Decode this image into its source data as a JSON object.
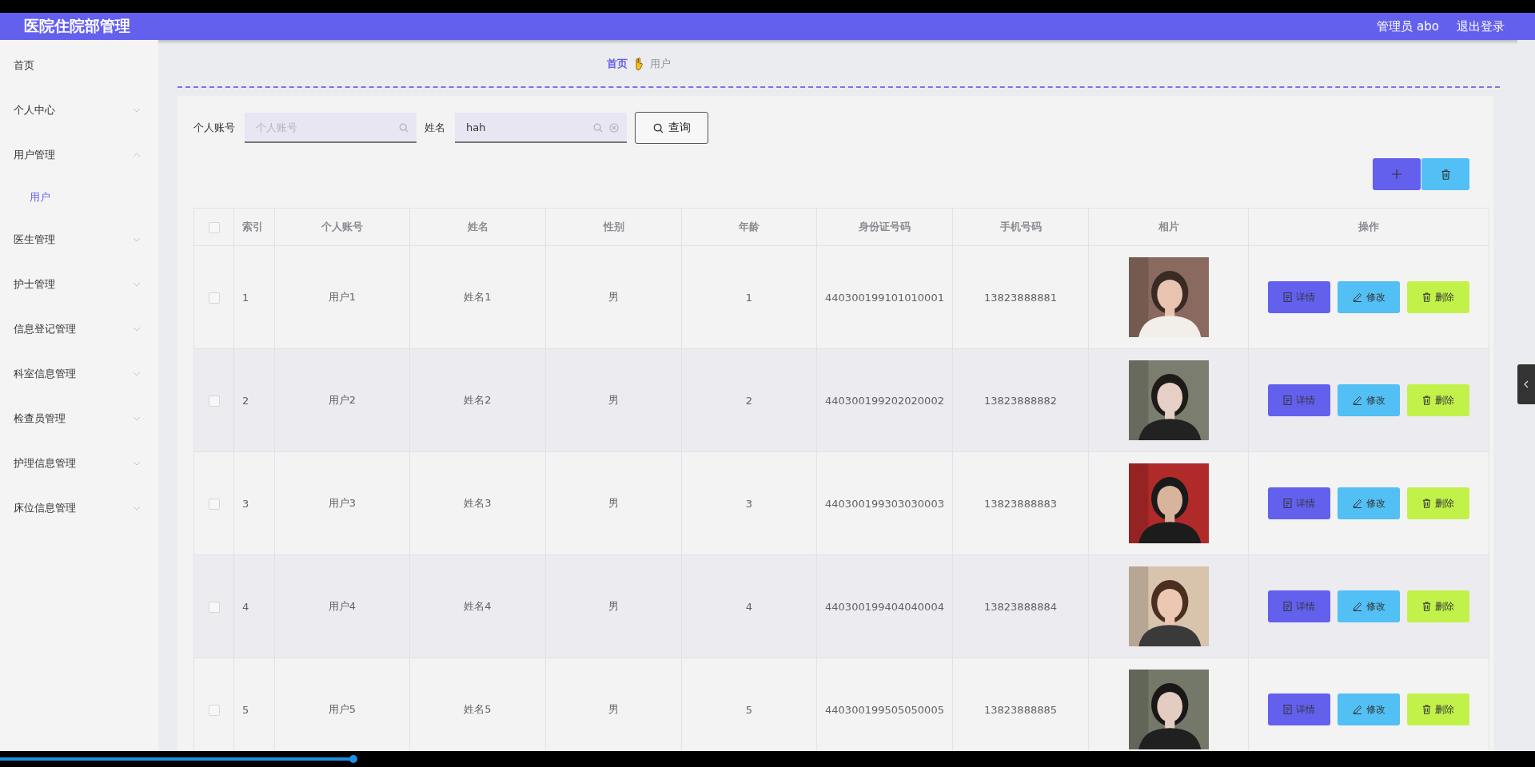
{
  "header": {
    "title": "医院住院部管理",
    "user": "管理员 abo",
    "logout": "退出登录"
  },
  "sidebar": {
    "items": [
      {
        "label": "首页",
        "selected": false
      },
      {
        "label": "个人中心",
        "expandable": true,
        "expanded": false,
        "selected": false
      },
      {
        "label": "用户管理",
        "expandable": true,
        "expanded": true,
        "selected": false,
        "children": [
          {
            "label": "用户",
            "selected": true
          }
        ]
      },
      {
        "label": "医生管理",
        "expandable": true,
        "expanded": false,
        "selected": false
      },
      {
        "label": "护士管理",
        "expandable": true,
        "expanded": false,
        "selected": false
      },
      {
        "label": "信息登记管理",
        "expandable": true,
        "expanded": false,
        "selected": false
      },
      {
        "label": "科室信息管理",
        "expandable": true,
        "expanded": false,
        "selected": false
      },
      {
        "label": "检查员管理",
        "expandable": true,
        "expanded": false,
        "selected": false
      },
      {
        "label": "护理信息管理",
        "expandable": true,
        "expanded": false,
        "selected": false
      },
      {
        "label": "床位信息管理",
        "expandable": true,
        "expanded": false,
        "selected": false
      }
    ]
  },
  "breadcrumb": [
    "首页",
    "用户"
  ],
  "search": {
    "fields": [
      {
        "label": "个人账号",
        "placeholder": "个人账号",
        "clearable": false
      },
      {
        "label": "姓名",
        "value": "hah",
        "clearable": true
      }
    ],
    "button": "查询"
  },
  "table": {
    "columns": [
      "索引",
      "个人账号",
      "姓名",
      "性别",
      "年龄",
      "身份证号码",
      "手机号码",
      "相片",
      "操作"
    ],
    "all_checked": false,
    "rows": [
      {
        "checked": false,
        "cells": [
          "1",
          "用户1",
          "姓名1",
          "男",
          "1",
          "440300199101010001",
          "13823888881"
        ],
        "actions": [
          "详情",
          "修改",
          "删除"
        ]
      },
      {
        "checked": false,
        "cells": [
          "2",
          "用户2",
          "姓名2",
          "男",
          "2",
          "440300199202020002",
          "13823888882"
        ],
        "actions": [
          "详情",
          "修改",
          "删除"
        ]
      },
      {
        "checked": false,
        "cells": [
          "3",
          "用户3",
          "姓名3",
          "男",
          "3",
          "440300199303030003",
          "13823888883"
        ],
        "actions": [
          "详情",
          "修改",
          "删除"
        ]
      },
      {
        "checked": false,
        "cells": [
          "4",
          "用户4",
          "姓名4",
          "男",
          "4",
          "440300199404040004",
          "13823888884"
        ],
        "actions": [
          "详情",
          "修改",
          "删除"
        ]
      },
      {
        "checked": false,
        "cells": [
          "5",
          "用户5",
          "姓名5",
          "男",
          "5",
          "440300199505050005",
          "13823888885"
        ],
        "actions": [
          "详情",
          "修改",
          "删除"
        ]
      }
    ]
  },
  "player": {
    "level": 0.23
  }
}
